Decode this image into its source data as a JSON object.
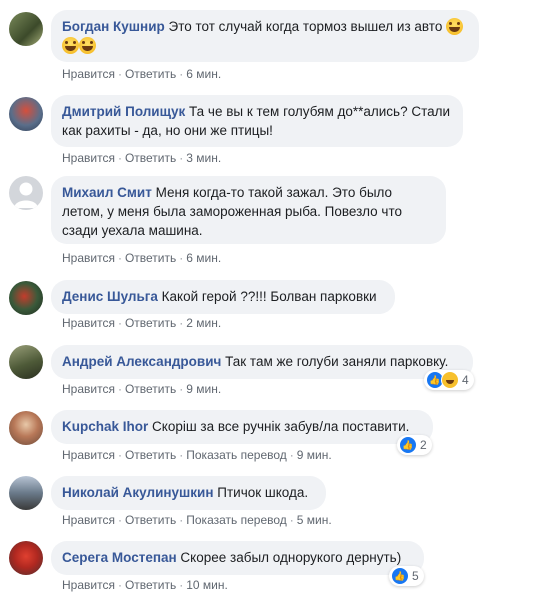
{
  "comments": [
    {
      "author": "Богдан Кушнир",
      "text": "Это тот случай когда тормоз вышел из авто",
      "emoji_icons": [
        "grinning-squinting-face",
        "grinning-squinting-face",
        "grinning-squinting-face"
      ],
      "like_label": "Нравится",
      "reply_label": "Ответить",
      "time": "6 мин."
    },
    {
      "author": "Дмитрий Полищук",
      "text": "Та че вы к тем голубям до**ались? Стали как рахиты - да, но они же птицы!",
      "like_label": "Нравится",
      "reply_label": "Ответить",
      "time": "3 мин."
    },
    {
      "author": "Михаил Смит",
      "text": "Меня когда-то такой зажал. Это было летом, у меня была замороженная рыба. Повезло что сзади уехала машина.",
      "like_label": "Нравится",
      "reply_label": "Ответить",
      "time": "6 мин."
    },
    {
      "author": "Денис Шульга",
      "text": "Какой герой ??!!! Болван парковки",
      "like_label": "Нравится",
      "reply_label": "Ответить",
      "time": "2 мин."
    },
    {
      "author": "Андрей Александрович",
      "text": "Так там же голуби заняли парковку.",
      "like_label": "Нравится",
      "reply_label": "Ответить",
      "time": "9 мин.",
      "reactions": {
        "icons": [
          "like-icon",
          "haha-icon"
        ],
        "count": "4"
      }
    },
    {
      "author": "Kupchak Ihor",
      "text": "Скоріш за все ручнік забув/ла поставити.",
      "like_label": "Нравится",
      "reply_label": "Ответить",
      "translate_label": "Показать перевод",
      "time": "9 мин.",
      "reactions": {
        "icons": [
          "like-icon"
        ],
        "count": "2"
      }
    },
    {
      "author": "Николай Акулинушкин",
      "text": "Птичок шкода.",
      "like_label": "Нравится",
      "reply_label": "Ответить",
      "translate_label": "Показать перевод",
      "time": "5 мин."
    },
    {
      "author": "Серега Мостепан",
      "text": "Скорее забыл однорукого дернуть)",
      "like_label": "Нравится",
      "reply_label": "Ответить",
      "time": "10 мин.",
      "reactions": {
        "icons": [
          "like-icon"
        ],
        "count": "5"
      }
    }
  ],
  "colors": {
    "author": "#385898",
    "bubble": "#f0f2f5",
    "meta": "#606770",
    "like": "#1877f2"
  }
}
